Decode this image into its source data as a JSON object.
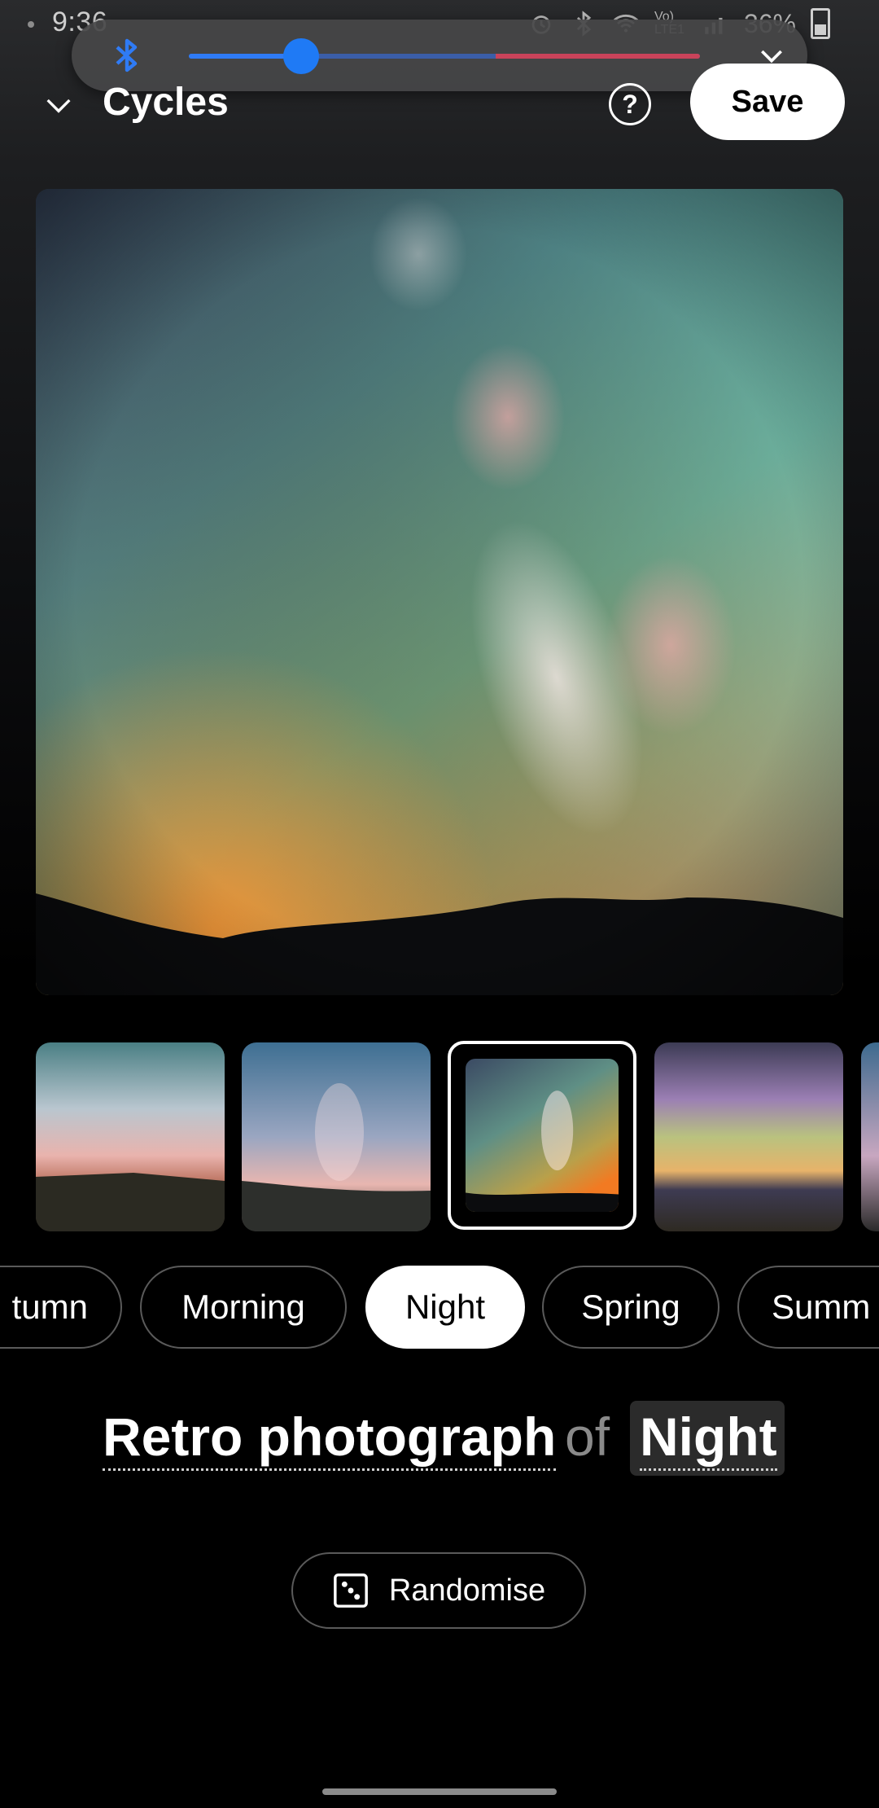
{
  "status_bar": {
    "time": "9:36",
    "battery_text": "36%",
    "network_label": "Vo) LTE1",
    "icons": [
      "alarm-icon",
      "bluetooth-icon",
      "wifi-icon",
      "signal-icon",
      "battery-icon"
    ]
  },
  "volume_panel": {
    "icon": "bluetooth-icon",
    "level": 0.22,
    "safe_limit": 0.6,
    "expand_icon": "chevron-down-icon",
    "colors": {
      "fill": "#2f7bf5",
      "track": "#3b5ea8",
      "danger": "#c9435a"
    }
  },
  "header": {
    "collapse_icon": "chevron-down-icon",
    "title": "Cycles",
    "help_label": "?",
    "save_label": "Save"
  },
  "preview": {
    "description_icon": "wallpaper-preview"
  },
  "thumbnails": [
    {
      "name": "thumb-1",
      "selected": false
    },
    {
      "name": "thumb-2",
      "selected": false
    },
    {
      "name": "thumb-3",
      "selected": true
    },
    {
      "name": "thumb-4",
      "selected": false
    },
    {
      "name": "thumb-5",
      "selected": false
    }
  ],
  "chips": [
    {
      "label": "tumn",
      "active": false
    },
    {
      "label": "Morning",
      "active": false
    },
    {
      "label": "Night",
      "active": true
    },
    {
      "label": "Spring",
      "active": false
    },
    {
      "label": "Summ",
      "active": false
    }
  ],
  "prompt": {
    "style": "Retro photograph",
    "connector": "of",
    "subject": "Night"
  },
  "randomise": {
    "icon": "dice-icon",
    "label": "Randomise"
  }
}
